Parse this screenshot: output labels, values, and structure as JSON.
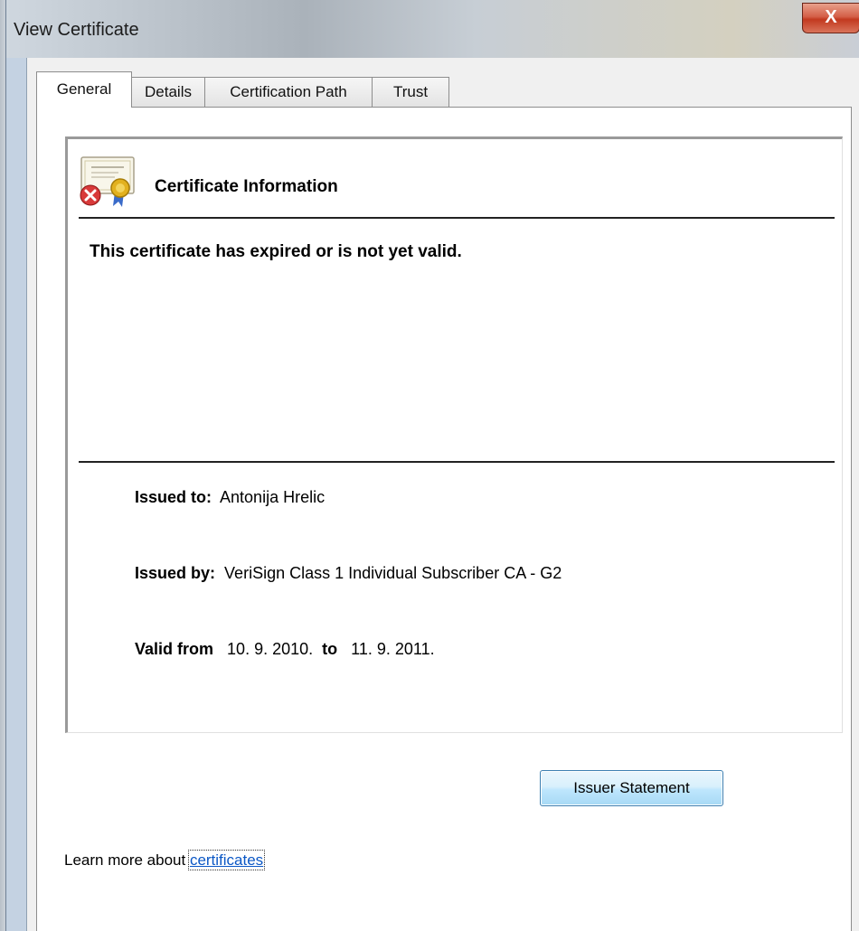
{
  "window": {
    "title": "View Certificate",
    "close_glyph": "X"
  },
  "tabs": [
    {
      "label": "General",
      "active": true
    },
    {
      "label": "Details",
      "active": false
    },
    {
      "label": "Certification Path",
      "active": false
    },
    {
      "label": "Trust",
      "active": false
    }
  ],
  "general": {
    "icon": "certificate-error-icon",
    "heading": "Certificate Information",
    "status_message": "This certificate has expired or is not yet valid.",
    "issued_to_label": "Issued to:",
    "issued_to_value": "Antonija Hrelic",
    "issued_by_label": "Issued by:",
    "issued_by_value": "VeriSign Class 1 Individual Subscriber CA - G2",
    "valid_from_label": "Valid from",
    "valid_from_value": "10. 9. 2010.",
    "valid_to_label": "to",
    "valid_to_value": "11. 9. 2011."
  },
  "buttons": {
    "issuer_statement": "Issuer Statement"
  },
  "footer": {
    "learn_more_prefix": "Learn more about",
    "learn_more_link": "certificates"
  },
  "colors": {
    "link": "#0b57c5",
    "close_button": "#c9452e",
    "button_border": "#3c7fb1"
  }
}
